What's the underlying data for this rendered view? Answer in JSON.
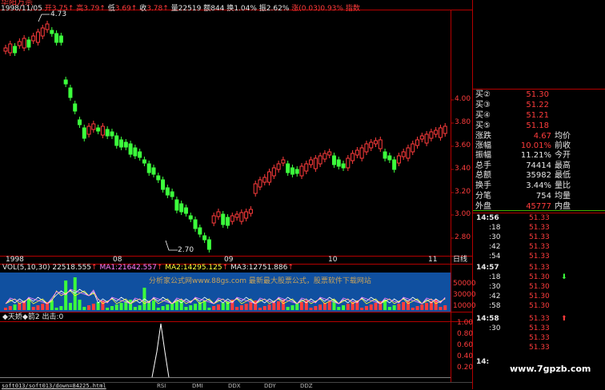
{
  "header": {
    "stock_name": "华阳万宗",
    "date": "1998/11/05",
    "open_label": "开",
    "open": "3.75",
    "high_label": "高",
    "high": "3.79",
    "low_label": "低",
    "low": "3.69",
    "close_label": "收",
    "close": "3.78",
    "vol_label": "量",
    "vol": "22519",
    "amt_label": "额",
    "amt": "844",
    "turn_label": "换",
    "turn": "1.04%",
    "amp_label": "振",
    "amp": "2.62%",
    "chg_label": "涨",
    "chg": "0.03",
    "pct": "0.93%",
    "index_label": "指数"
  },
  "price_axis": [
    "4.00",
    "3.80",
    "3.60",
    "3.40",
    "3.20",
    "3.00",
    "2.80"
  ],
  "date_axis": [
    "1998",
    "08",
    "09",
    "10",
    "11"
  ],
  "chart_mode_label": "日线",
  "annotations": {
    "high_marker": "4.73",
    "low_marker": "2.70"
  },
  "vol_header": {
    "label": "VOL(5,10,30)",
    "vol": "22518.555",
    "ma1": "MA1:21642.557",
    "ma2": "MA2:14295.125",
    "ma3": "MA3:12751.886",
    "ad_text": "分析家公式网www.88gs.com 最新最大股票公式，股票软件下载网站"
  },
  "vol_axis": [
    "50000",
    "30000",
    "10000"
  ],
  "indicator_header": {
    "label1": "天娇",
    "label2": "箭2",
    "label3": "出击:0"
  },
  "indicator_axis": [
    "1.00",
    "0.80",
    "0.60",
    "0.40",
    "0.20"
  ],
  "order_book": [
    {
      "label": "买②",
      "price": "51.30"
    },
    {
      "label": "买③",
      "price": "51.22"
    },
    {
      "label": "买④",
      "price": "51.21"
    },
    {
      "label": "买⑤",
      "price": "51.18"
    }
  ],
  "stats": [
    {
      "l1": "涨跌",
      "v": "4.67",
      "l2": "均价",
      "color": "red"
    },
    {
      "l1": "涨幅",
      "v": "10.01%",
      "l2": "前收",
      "color": "red"
    },
    {
      "l1": "振幅",
      "v": "11.21%",
      "l2": "今开",
      "color": "white"
    },
    {
      "l1": "总手",
      "v": "74414",
      "l2": "最高",
      "color": "white"
    },
    {
      "l1": "总额",
      "v": "35982",
      "l2": "最低",
      "color": "white"
    },
    {
      "l1": "换手",
      "v": "3.44%",
      "l2": "量比",
      "color": "white"
    },
    {
      "l1": "分笔",
      "v": "754",
      "l2": "均量",
      "color": "white"
    },
    {
      "l1": "外盘",
      "v": "45777",
      "l2": "内盘",
      "color": "red"
    }
  ],
  "ticks_a": {
    "time": "14:56",
    "rows": [
      {
        "t": "",
        "p": "51.33"
      },
      {
        "t": ":18",
        "p": "51.33"
      },
      {
        "t": ":30",
        "p": "51.33"
      },
      {
        "t": ":42",
        "p": "51.33"
      },
      {
        "t": ":54",
        "p": "51.33"
      }
    ]
  },
  "ticks_b": {
    "time": "14:57",
    "rows": [
      {
        "t": "",
        "p": "51.33"
      },
      {
        "t": ":18",
        "p": "51.30"
      },
      {
        "t": ":30",
        "p": "51.30"
      },
      {
        "t": ":42",
        "p": "51.30"
      },
      {
        "t": ":58",
        "p": "51.30"
      }
    ]
  },
  "ticks_c": {
    "time": "14:58",
    "rows": [
      {
        "t": "",
        "p": "51.33"
      },
      {
        "t": ":30",
        "p": "51.33"
      },
      {
        "t": "",
        "p": "51.33"
      },
      {
        "t": "",
        "p": "51.33"
      }
    ]
  },
  "ticks_d": {
    "time": "14:"
  },
  "watermark": "www.7gpzb.com",
  "status_bar": {
    "path": "soft013/soft013/down=84225.html",
    "tabs": [
      "RSI",
      "DMI",
      "DDX",
      "DDY",
      "DDZ"
    ]
  },
  "colors": {
    "up": "#ff3c3c",
    "down": "#3cff3c",
    "axis": "#b40000",
    "vol_bg": "#1050a0"
  }
}
